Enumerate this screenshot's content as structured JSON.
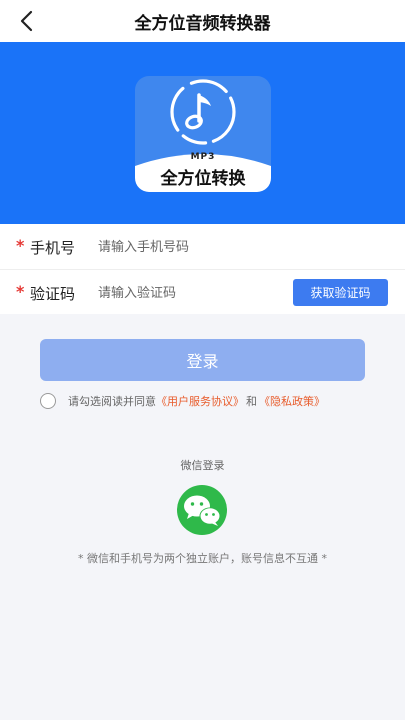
{
  "header": {
    "title": "全方位音频转换器",
    "back_icon": "chevron-left-icon"
  },
  "banner": {
    "background_color": "#1a73f8",
    "logo": {
      "icon": "music-note-icon",
      "subtitle": "MP3",
      "name": "全方位转换"
    }
  },
  "form": {
    "phone": {
      "required_mark": "*",
      "label": "手机号",
      "placeholder": "请输入手机号码",
      "value": ""
    },
    "code": {
      "required_mark": "*",
      "label": "验证码",
      "placeholder": "请输入验证码",
      "value": "",
      "get_code_label": "获取验证码"
    }
  },
  "login": {
    "button_label": "登录",
    "button_color": "#8eaef0"
  },
  "agreement": {
    "checked": false,
    "prefix": "请勾选阅读并同意",
    "user_agreement": "《用户服务协议》",
    "and": "和",
    "privacy_policy": "《隐私政策》",
    "link_color": "#e85c2c"
  },
  "wechat": {
    "title": "微信登录",
    "icon": "wechat-icon",
    "color": "#2fb94a"
  },
  "footnote": "* 微信和手机号为两个独立账户，账号信息不互通 *"
}
